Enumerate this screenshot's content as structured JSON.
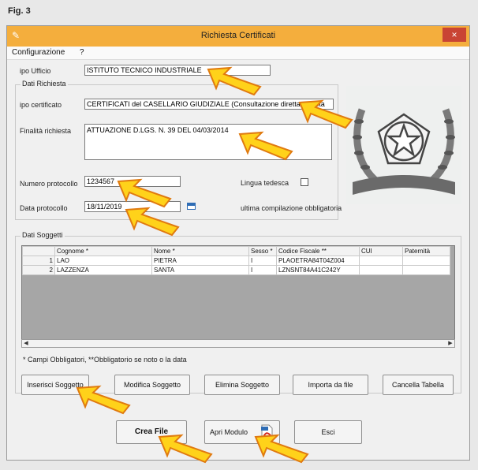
{
  "figure_label": "Fig. 3",
  "window": {
    "title": "Richiesta Certificati",
    "close_glyph": "×"
  },
  "menu": [
    "Configurazione",
    "?"
  ],
  "form": {
    "tipo_ufficio": {
      "label": "ipo Ufficio",
      "value": "ISTITUTO TECNICO INDUSTRIALE"
    },
    "group_title": "Dati Richiesta",
    "tipo_certificato": {
      "label": "ipo certificato",
      "value": "CERTIFICATI del CASELLARIO GIUDIZIALE (Consultazione diretta vaaista"
    },
    "finalita": {
      "label": "Finalità richiesta",
      "value": "ATTUAZIONE D.LGS. N. 39 DEL 04/03/2014"
    },
    "numero_protocollo": {
      "label": "Numero protocollo",
      "value": "1234567"
    },
    "lingua": {
      "label": "Lingua tedesca"
    },
    "data_protocollo": {
      "label": "Data protocollo",
      "value": "18/11/2019"
    },
    "compilazione_label": "ultima compilazione obbligatoria"
  },
  "soggetti": {
    "group_title": "Dati Soggetti",
    "columns": [
      "",
      "Cognome *",
      "Nome *",
      "Sesso *",
      "Codice Fiscale **",
      "CUI",
      "Paternità"
    ],
    "rows": [
      [
        "1",
        "LAO",
        "PIETRA",
        "I",
        "PLAOETRA84T04Z004",
        "",
        ""
      ],
      [
        "2",
        "LAZZENZA",
        "SANTA",
        "I",
        "LZNSNT84A41C242Y",
        "",
        ""
      ]
    ],
    "note": "* Campi Obbligatori, **Obbligatorio se noto o la data"
  },
  "buttons": {
    "inserisci": "Inserisci Soggetto",
    "modifica": "Modifica Soggetto",
    "elimina": "Elimina Soggetto",
    "importa": "Importa da file",
    "cancella": "Cancella Tabella",
    "crea": "Crea File",
    "apri": "Apri Modulo",
    "esci": "Esci"
  },
  "colors": {
    "titlebar": "#f4ae3d",
    "close": "#c94434",
    "arrow_fill": "#ffd21a",
    "arrow_stroke": "#e07a10"
  }
}
